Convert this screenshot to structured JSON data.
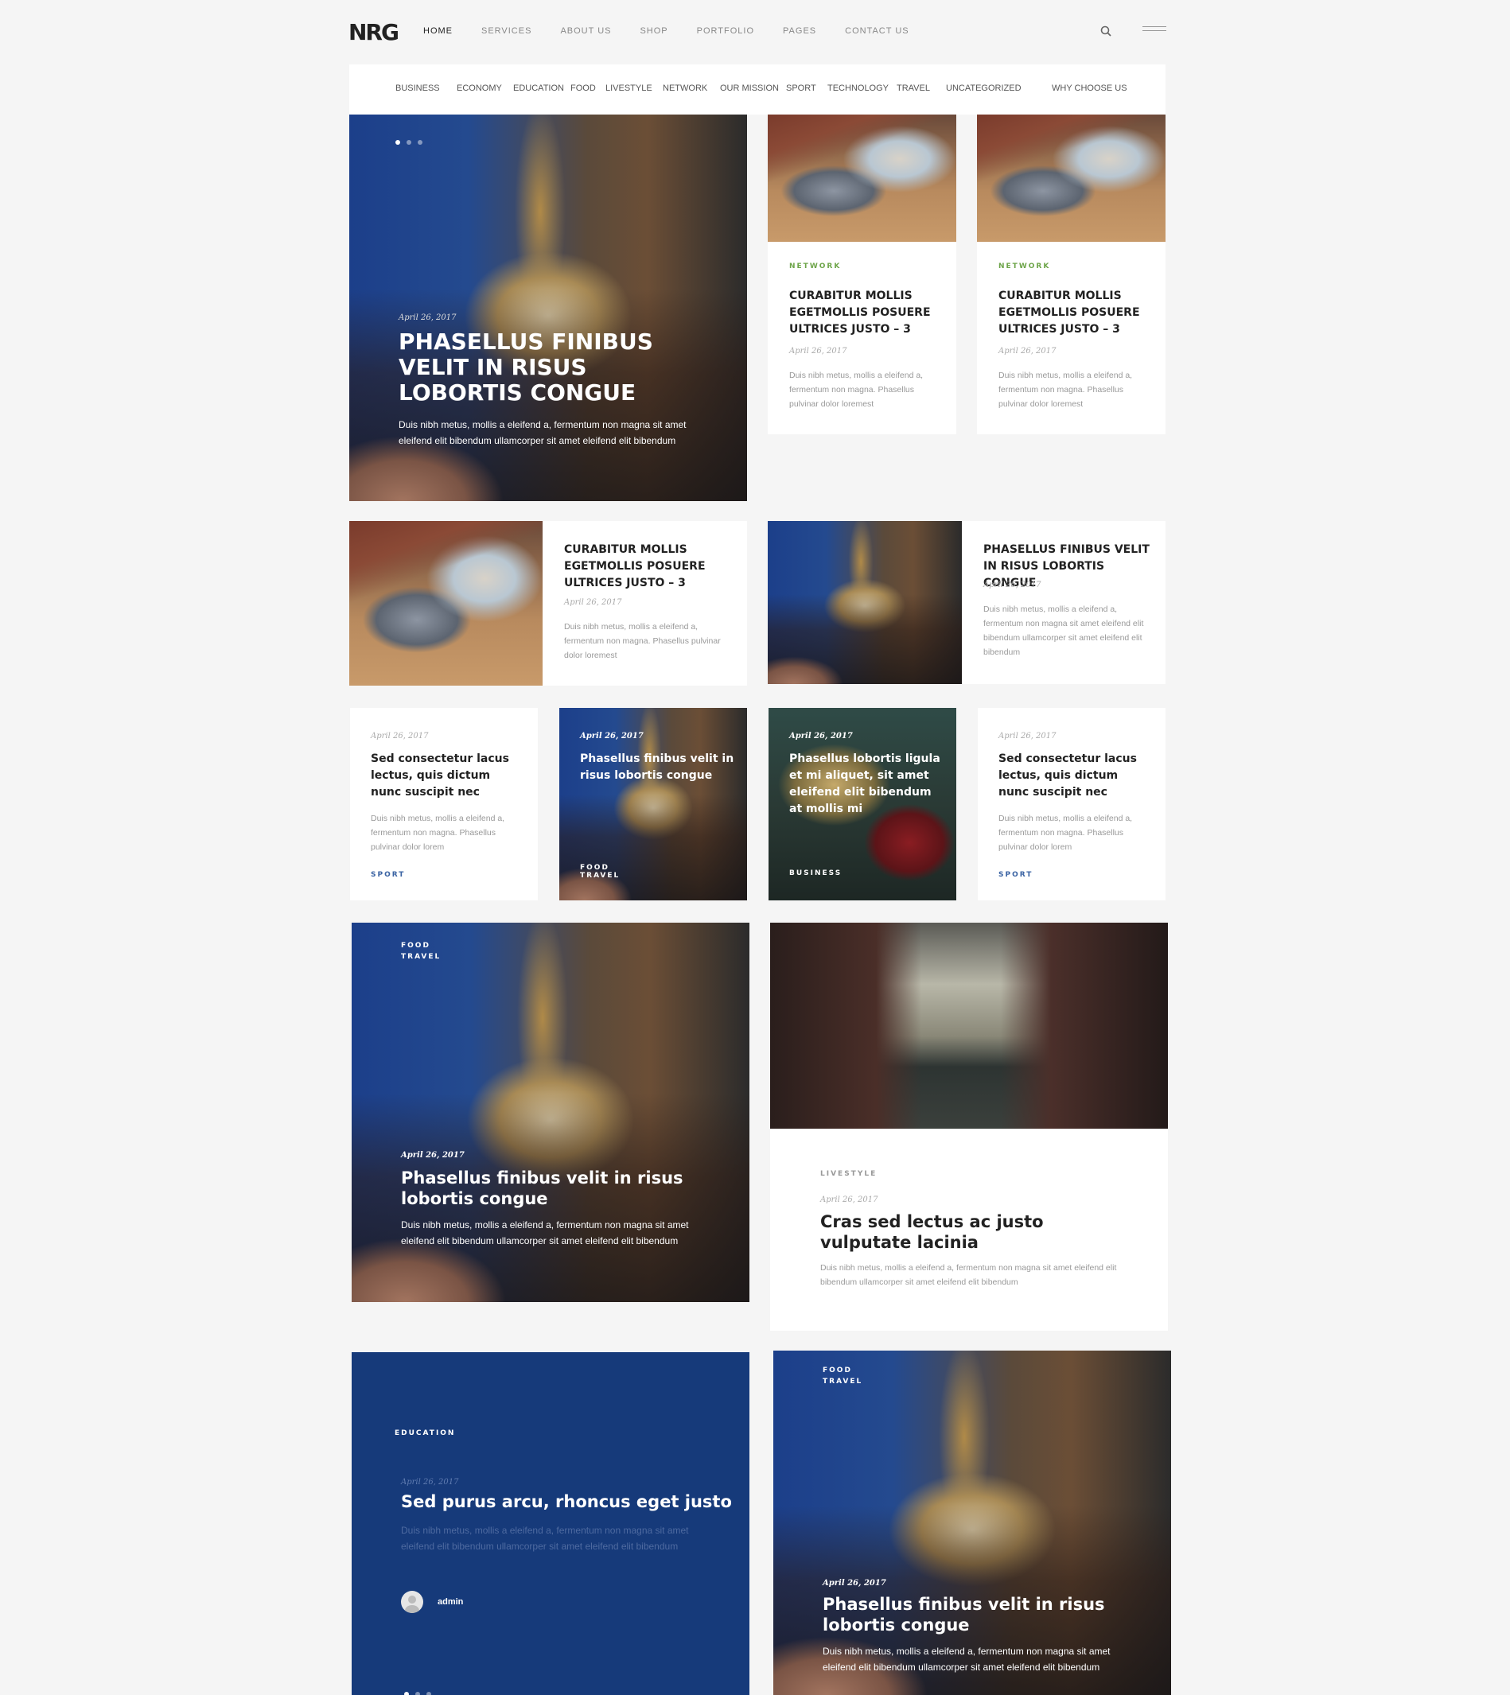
{
  "logo": "NRG",
  "main_nav": [
    "HOME",
    "SERVICES",
    "ABOUT US",
    "SHOP",
    "PORTFOLIO",
    "PAGES",
    "CONTACT US"
  ],
  "categories": [
    "BUSINESS",
    "ECONOMY",
    "EDUCATION",
    "FOOD",
    "LIVESTYLE",
    "NETWORK",
    "OUR MISSION",
    "SPORT",
    "TECHNOLOGY",
    "TRAVEL",
    "UNCATEGORIZED",
    "WHY CHOOSE US"
  ],
  "hero": {
    "date": "April 26, 2017",
    "title": "PHASELLUS FINIBUS VELIT IN RISUS LOBORTIS CONGUE",
    "excerpt": "Duis nibh metus, mollis a eleifend a, fermentum non magna sit amet eleifend elit bibendum ullamcorper sit amet eleifend elit bibendum"
  },
  "top_cards": [
    {
      "category": "NETWORK",
      "title": "CURABITUR MOLLIS EGETMOLLIS POSUERE ULTRICES JUSTO – 3",
      "date": "April 26, 2017",
      "excerpt": "Duis nibh metus, mollis a eleifend a, fermentum non magna. Phasellus pulvinar dolor loremest"
    },
    {
      "category": "NETWORK",
      "title": "CURABITUR MOLLIS EGETMOLLIS POSUERE ULTRICES JUSTO – 3",
      "date": "April 26, 2017",
      "excerpt": "Duis nibh metus, mollis a eleifend a, fermentum non magna. Phasellus pulvinar dolor loremest"
    }
  ],
  "side_cards": [
    {
      "title": "CURABITUR MOLLIS EGETMOLLIS POSUERE ULTRICES JUSTO – 3",
      "date": "April 26, 2017",
      "excerpt": "Duis nibh metus, mollis a eleifend a, fermentum non magna. Phasellus pulvinar dolor loremest"
    },
    {
      "title": "PHASELLUS FINIBUS VELIT IN RISUS LOBORTIS CONGUE",
      "date": "April 26, 2017",
      "excerpt": "Duis nibh metus, mollis a eleifend a, fermentum non magna sit amet eleifend elit bibendum ullamcorper sit amet eleifend elit bibendum"
    }
  ],
  "small_cards": [
    {
      "date": "April 26, 2017",
      "title": "Sed consectetur lacus lectus, quis dictum nunc suscipit nec",
      "excerpt": "Duis nibh metus, mollis a eleifend a, fermentum non magna. Phasellus pulvinar dolor lorem",
      "category": "SPORT"
    },
    {
      "date": "April 26, 2017",
      "title": "Phasellus finibus velit in risus lobortis congue",
      "category": "FOOD\nTRAVEL"
    },
    {
      "date": "April 26, 2017",
      "title": "Phasellus lobortis ligula et mi aliquet, sit amet eleifend elit bibendum at mollis mi",
      "category": "BUSINESS"
    },
    {
      "date": "April 26, 2017",
      "title": "Sed consectetur lacus lectus, quis dictum nunc suscipit nec",
      "excerpt": "Duis nibh metus, mollis a eleifend a, fermentum non magna. Phasellus pulvinar dolor lorem",
      "category": "SPORT"
    }
  ],
  "big_left": {
    "category": "FOOD\nTRAVEL",
    "date": "April 26, 2017",
    "title": "Phasellus finibus velit in risus lobortis congue",
    "excerpt": "Duis nibh metus, mollis a eleifend a, fermentum non magna sit amet eleifend elit bibendum ullamcorper sit amet eleifend elit bibendum"
  },
  "big_right": {
    "category": "LIVESTYLE",
    "date": "April 26, 2017",
    "title": "Cras sed lectus ac justo vulputate lacinia",
    "excerpt": "Duis nibh metus, mollis a eleifend a, fermentum non magna sit amet eleifend elit bibendum ullamcorper sit amet eleifend elit bibendum"
  },
  "blue_card": {
    "category": "EDUCATION",
    "date": "April 26, 2017",
    "title": "Sed purus arcu, rhoncus eget justo",
    "excerpt": "Duis nibh metus, mollis a eleifend a, fermentum non magna sit amet eleifend elit bibendum ullamcorper sit amet eleifend elit bibendum",
    "author": "admin"
  },
  "bottom_right": {
    "category": "FOOD\nTRAVEL",
    "date": "April 26, 2017",
    "title": "Phasellus finibus velit in risus lobortis congue",
    "excerpt": "Duis nibh metus, mollis a eleifend a, fermentum non magna sit amet eleifend elit bibendum ullamcorper sit amet eleifend elit bibendum"
  },
  "colors": {
    "blue_card": "#163a7a",
    "network": "#6ea54a",
    "sport": "#3a63a3"
  }
}
